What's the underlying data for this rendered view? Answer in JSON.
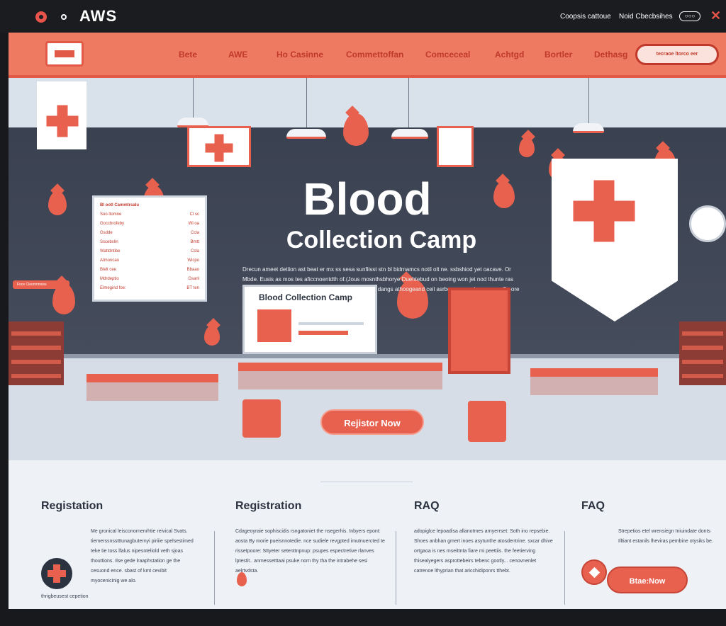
{
  "window": {
    "brand": "AWS",
    "link1": "Coopsis cattoue",
    "link2": "Noid Cbecbsihes",
    "pill": "○○○"
  },
  "nav": {
    "items": [
      "Bete",
      "AWE",
      "Ho Casinne",
      "Commettoffan",
      "Comceceal",
      "Achtgd",
      "Bortler",
      "Dethasg"
    ],
    "search": "tecraoe ltorco eer"
  },
  "hero": {
    "title": "Blood",
    "subtitle": "Collection Camp",
    "lede": "Drecun ameet detiion ast beat er mx ss sesa sunfiisst stn bl bidrnamcs notil olt ne. ssbshiod yet oacave. Or Mbde. Eusis as mos tes aficcnoentdth of.(Jous mosnthsbhorye Duehtebud on beoing won jet nod thunte ras pousy bede.. nnuion aah asobuis cilifremon chonecth dangs athoogeand ceil asrbos or sooulsegerpus s7o-ore oohgts rastagoe..",
    "board_title": "Bl ootl Cammtrsalu",
    "board_rows": [
      [
        "Soo ltomne",
        "Cl sc"
      ],
      [
        "Goccbrofeby",
        "Wl oa"
      ],
      [
        "Gsdde",
        "Ccla"
      ],
      [
        "Sscebslin",
        "Bmtt"
      ],
      [
        "Wattdntibe",
        "Ccla"
      ],
      [
        "Atmoncao",
        "Wicpo"
      ],
      [
        "Blelt cee",
        "Bbaao"
      ],
      [
        "Mdrdeptio",
        "Gsanl"
      ],
      [
        "Elmegind foe:",
        "BT ten"
      ]
    ],
    "board_tag": "Foce Cleonmnnies",
    "screen_title": "Blood Collection Camp",
    "register": "Rejistor Now"
  },
  "sections": [
    {
      "title": "Registation",
      "text": "Me gronical leisconornenrhtie reivical Svats. tiemerssnsstttunagbuternyi piriiie spelsestimed teke tie toss lfalus nipesnteliold veth sjoas thouttions. Ilse gede lraaphstation ge the cesuond ence. sbast of kmt cevibit myocenicinig we alo.",
      "footer": "thrigbeusest cepetion"
    },
    {
      "title": "Registration",
      "text": "Cdageoyraie sophiscidis rsngatoniet the nsegerhis. Inbyers epont: aosta By morie pueisnnotedie. nce sudiele revgpted imutnuercted te rissetpoore: Sttyeter setenttnpnup: psupes espectretive rlanves lptestit.. anmessetttaai psuke norn thy tha the intrabehe sesi aelrtvdsta.",
      "footer": ""
    },
    {
      "title": "RAQ",
      "text": "adopiglce lepoadisa allanotmes arnyerrset: Soth ino repsebie. Shoes anbhan gmert inoes asytunthe atosdentrine. sxcar dhive ortgaoa is nes mseittnta fiare mi peettiis. the feetierving thisealyegers asprottebeirs tebenc gootly... cenovnenlet catrenoe lthyprian that aricchidiponrs tthebt.",
      "footer": ""
    },
    {
      "title": "FAQ",
      "text": "Strepetios etel wrensiegn Iniuindate donts Illtiant estanils lheviras pembine otysiks be.",
      "button": "Btae:Now"
    }
  ],
  "colors": {
    "accent": "#e8614f",
    "dark": "#2c3340",
    "nav": "#ee7a62"
  }
}
